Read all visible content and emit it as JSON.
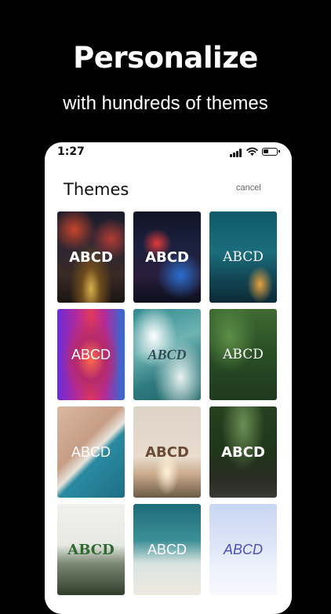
{
  "headline": "Personalize",
  "subline": "with hundreds of themes",
  "status_bar": {
    "time": "1:27",
    "icons": [
      "signal-icon",
      "wifi-icon",
      "battery-icon"
    ]
  },
  "screen": {
    "title": "Themes",
    "cancel_label": "cancel"
  },
  "themes": [
    {
      "label": "ABCD",
      "style": "bold sans, city night"
    },
    {
      "label": "ABCD",
      "style": "bold sans, neon street"
    },
    {
      "label": "ABCD",
      "style": "serif, blue sky"
    },
    {
      "label": "ABCD",
      "style": "light sans, neon tunnel"
    },
    {
      "label": "ABCD",
      "style": "italic serif, waves"
    },
    {
      "label": "ABCD",
      "style": "serif, green hills"
    },
    {
      "label": "ABCD",
      "style": "light sans, beach aerial"
    },
    {
      "label": "ABCD",
      "style": "bold brown, sunset desert"
    },
    {
      "label": "ABCD",
      "style": "bold sans, forest bridge"
    },
    {
      "label": "ABCD",
      "style": "bold green serif, misty forest"
    },
    {
      "label": "ABCD",
      "style": "light sans, beach people"
    },
    {
      "label": "ABCD",
      "style": "italic blue, sky"
    }
  ],
  "colors": {
    "background": "#000000",
    "phone_surface": "#ffffff",
    "title_text": "#111111",
    "cancel_text": "#666666"
  }
}
